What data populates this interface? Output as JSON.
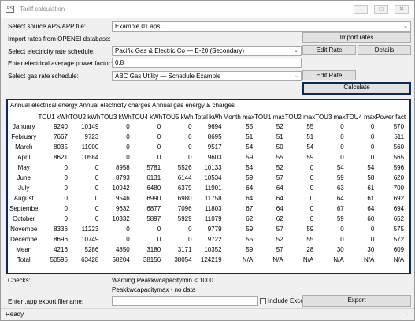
{
  "window": {
    "title": "Tariff calculation",
    "icon_text": "RS"
  },
  "controls": {
    "minimize": "–",
    "maximize": "□",
    "close": "✕"
  },
  "form": {
    "source_label": "Select source APS/APP file:",
    "source_value": "Example 01.aps",
    "import_label": "Import rates from OPENEI database:",
    "import_button": "Import rates",
    "elec_label": "Select electricity rate schedule:",
    "elec_value": "Pacific Gas & Electric Co — E-20 (Secondary)",
    "edit_rate_button": "Edit Rate",
    "details_button": "Details",
    "pf_label": "Enter electrical average power factor:",
    "pf_value": "0.8",
    "gas_label": "Select gas rate schedule:",
    "gas_value": "ABC Gas Utility — Schedule Example",
    "gas_edit_button": "Edit Rate",
    "calculate_button": "Calculate"
  },
  "results": {
    "title": "Annual electrical energy Annual electricity charges Annual gas energy & charges",
    "columns": [
      "",
      "TOU1 kWh",
      "TOU2 kWh",
      "TOU3 kWh",
      "TOU4 kWh",
      "TOU5 kWh",
      "Total kWh",
      "Month max",
      "TOU1 max",
      "TOU2 max",
      "TOU3 max",
      "TOU4 max",
      "Power fact"
    ],
    "rows": [
      [
        "January",
        "9240",
        "10149",
        "0",
        "0",
        "0",
        "9694",
        "55",
        "52",
        "55",
        "0",
        "0",
        "570"
      ],
      [
        "February",
        "7667",
        "9723",
        "0",
        "0",
        "0",
        "8695",
        "51",
        "51",
        "51",
        "0",
        "0",
        "511"
      ],
      [
        "March",
        "8035",
        "11000",
        "0",
        "0",
        "0",
        "9517",
        "54",
        "50",
        "54",
        "0",
        "0",
        "560"
      ],
      [
        "April",
        "8621",
        "10584",
        "0",
        "0",
        "0",
        "9603",
        "59",
        "55",
        "59",
        "0",
        "0",
        "565"
      ],
      [
        "May",
        "0",
        "0",
        "8958",
        "5781",
        "5526",
        "10133",
        "54",
        "52",
        "0",
        "54",
        "54",
        "596"
      ],
      [
        "June",
        "0",
        "0",
        "8793",
        "6131",
        "6144",
        "10534",
        "59",
        "57",
        "0",
        "59",
        "58",
        "620"
      ],
      [
        "July",
        "0",
        "0",
        "10942",
        "6480",
        "6379",
        "11901",
        "64",
        "64",
        "0",
        "63",
        "61",
        "700"
      ],
      [
        "August",
        "0",
        "0",
        "9546",
        "6990",
        "6980",
        "11758",
        "64",
        "64",
        "0",
        "64",
        "61",
        "692"
      ],
      [
        "Septembe",
        "0",
        "0",
        "9632",
        "6877",
        "7096",
        "11803",
        "67",
        "64",
        "0",
        "67",
        "64",
        "694"
      ],
      [
        "October",
        "0",
        "0",
        "10332",
        "5897",
        "5929",
        "11079",
        "62",
        "62",
        "0",
        "59",
        "60",
        "652"
      ],
      [
        "Novembe",
        "8336",
        "11223",
        "0",
        "0",
        "0",
        "9779",
        "59",
        "57",
        "59",
        "0",
        "0",
        "575"
      ],
      [
        "Decembe",
        "8696",
        "10749",
        "0",
        "0",
        "0",
        "9722",
        "55",
        "52",
        "55",
        "0",
        "0",
        "572"
      ],
      [
        "Mean",
        "4216",
        "5286",
        "4850",
        "3180",
        "3171",
        "10352",
        "59",
        "57",
        "28",
        "30",
        "30",
        "609"
      ],
      [
        "Total",
        "50595",
        "63428",
        "58204",
        "38156",
        "38054",
        "124219",
        "N/A",
        "N/A",
        "N/A",
        "N/A",
        "N/A",
        "N/A"
      ]
    ]
  },
  "checks": {
    "label": "Checks:",
    "line1": "Warning Peakkwcapacitymin < 1000",
    "line2": "Peakkwcapacitymax - no data"
  },
  "export": {
    "label": "Enter .app export filename:",
    "value": "",
    "include_excel_label": "Include Excel",
    "include_excel_checked": false,
    "button": "Export"
  },
  "status": {
    "text": "Ready."
  },
  "colors": {
    "focus_border": "#0b2a5b",
    "button_bg": "#e1e1e1",
    "window_bg": "#f0f0f0"
  }
}
